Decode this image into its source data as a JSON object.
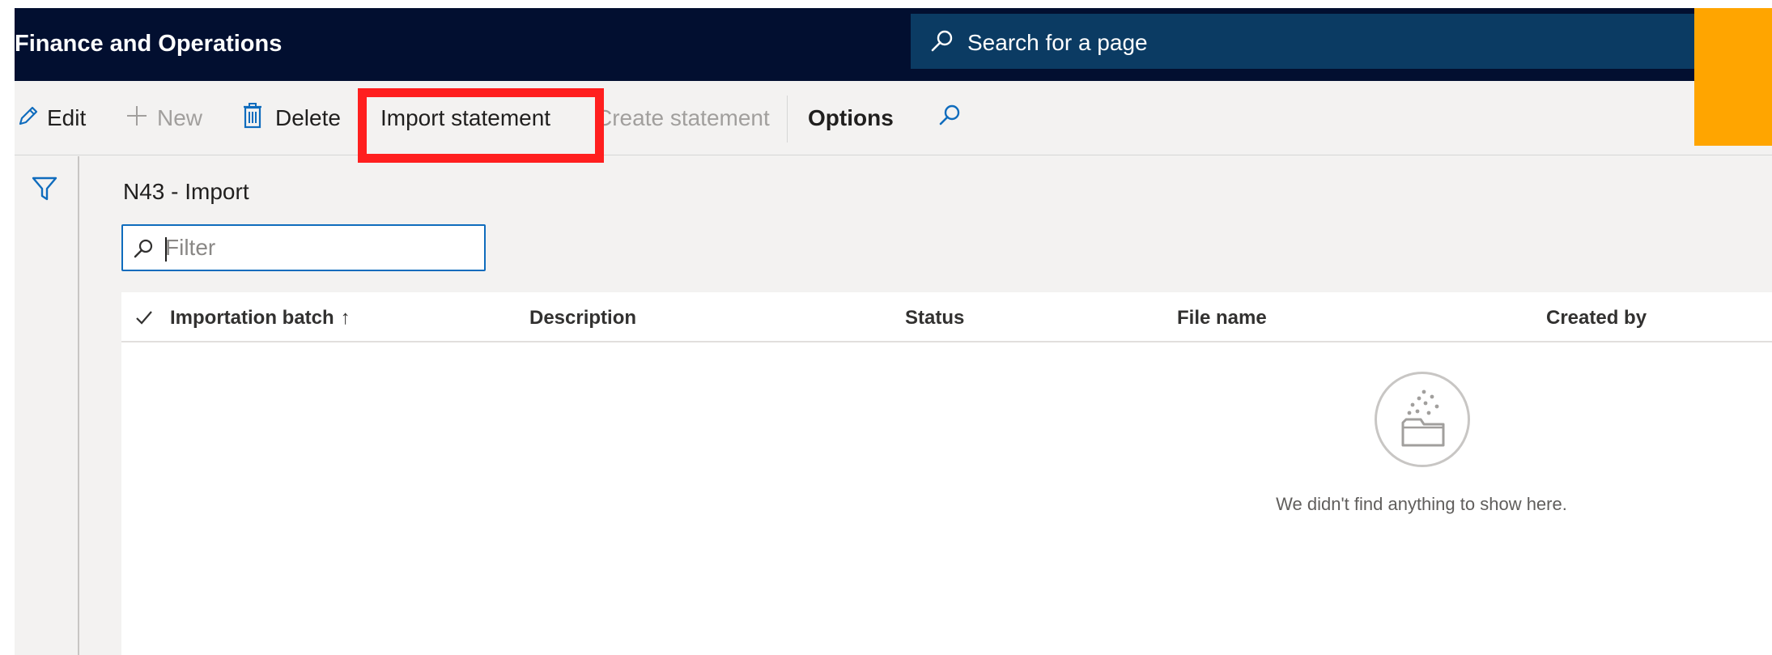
{
  "header": {
    "app_title": "Finance and Operations",
    "search_placeholder": "Search for a page"
  },
  "toolbar": {
    "edit_label": "Edit",
    "new_label": "New",
    "delete_label": "Delete",
    "import_statement_label": "Import statement",
    "create_statement_label": "Create statement",
    "options_label": "Options"
  },
  "page": {
    "title": "N43 - Import",
    "filter_placeholder": "Filter"
  },
  "grid": {
    "columns": [
      "Importation batch",
      "Description",
      "Status",
      "File name",
      "Created by"
    ],
    "sort_indicator": "↑",
    "rows": [],
    "empty_message": "We didn't find anything to show here."
  },
  "colors": {
    "topbar": "#020f30",
    "search_box": "#0b3b63",
    "highlight": "#ff1f1f",
    "accent_orange": "#ffa500",
    "link_blue": "#0f6cbd"
  },
  "icons": [
    "search-icon",
    "edit-icon",
    "add-icon",
    "delete-icon",
    "search-toolbar-icon",
    "filter-icon",
    "checkmark-icon",
    "empty-folder-icon"
  ]
}
